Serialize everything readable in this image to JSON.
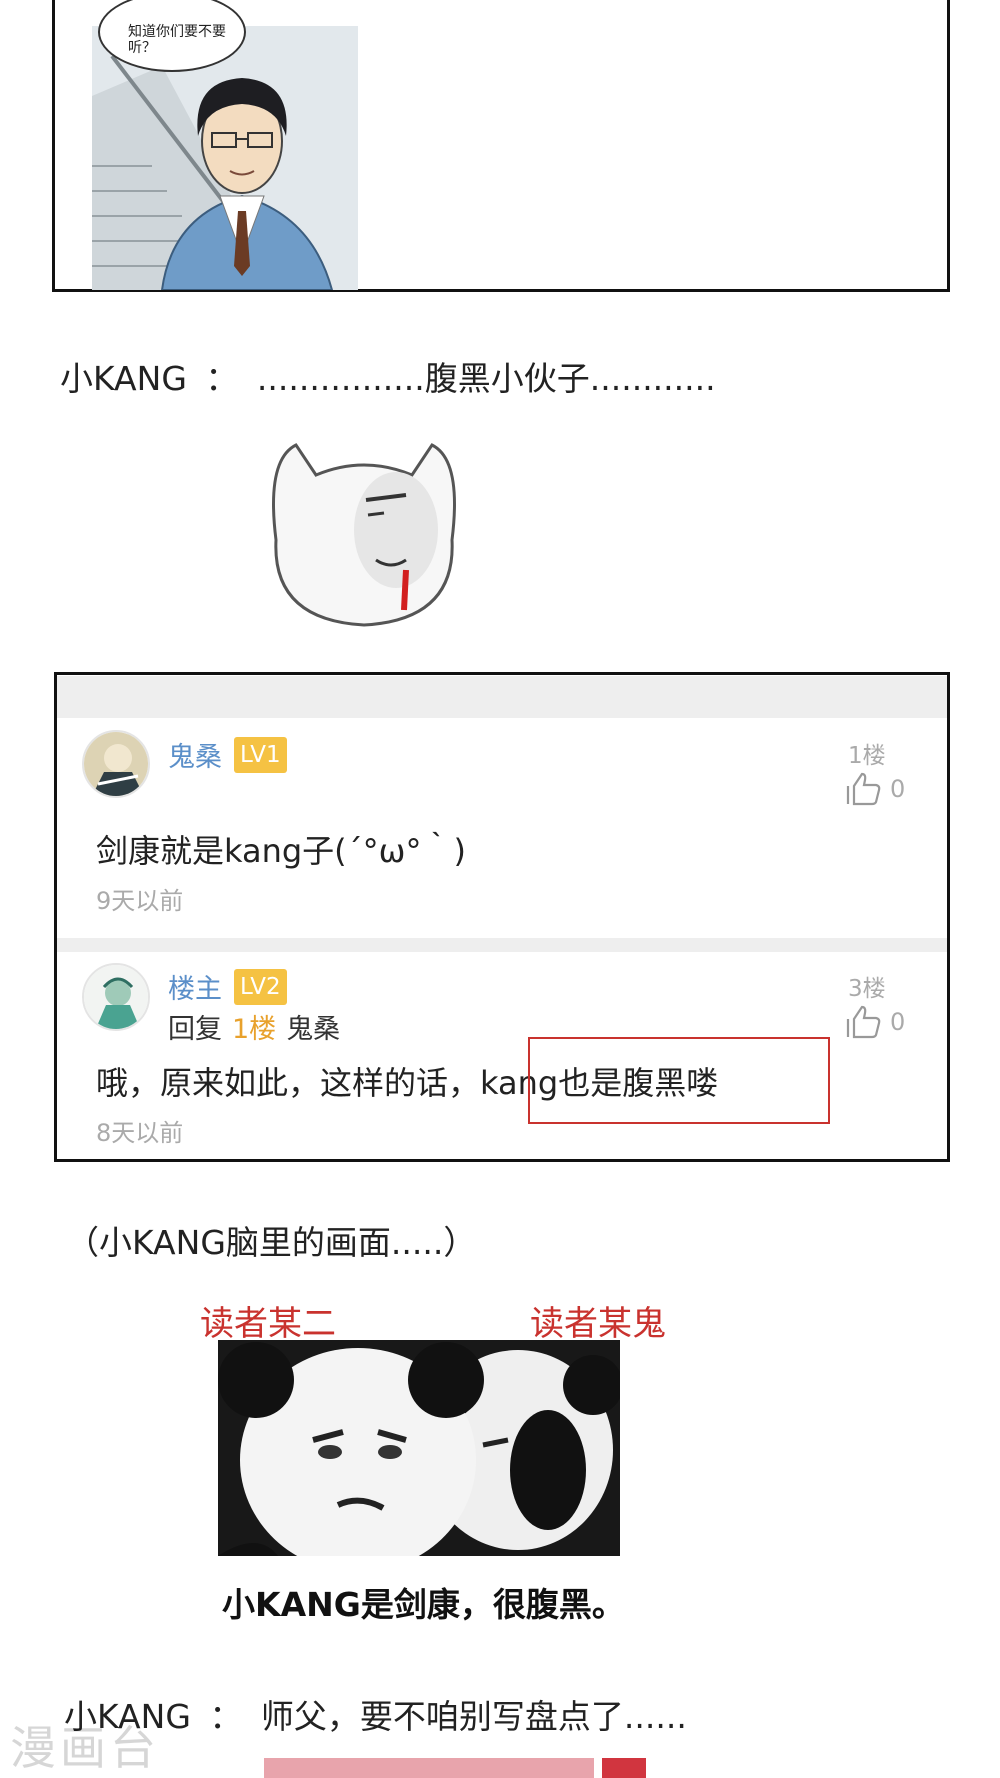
{
  "comic_panel": {
    "speech_bubble": "知道你们要不要听？"
  },
  "line1": {
    "speaker": "小KANG",
    "sep": "：",
    "text": "................腹黑小伙子............"
  },
  "comments": {
    "items": [
      {
        "username": "鬼桑",
        "level": "LV1",
        "floor": "1楼",
        "likes": "0",
        "text": "剑康就是kang子(´°ω°｀)",
        "time": "9天以前"
      },
      {
        "username": "楼主",
        "level": "LV2",
        "floor": "3楼",
        "likes": "0",
        "reply_prefix": "回复",
        "reply_floor": "1楼",
        "reply_user": "鬼桑",
        "text_before": "哦，原来如此，这样的话，",
        "text_highlight": "kang也是腹黑喽",
        "time": "8天以前"
      }
    ]
  },
  "line2": {
    "text": "（小KANG脑里的画面.....）"
  },
  "meme": {
    "label_left": "读者某二",
    "label_right": "读者某鬼",
    "caption": "小KANG是剑康，很腹黑。"
  },
  "line3": {
    "speaker": "小KANG",
    "sep": "：",
    "text": "师父，要不咱别写盘点了......"
  },
  "watermark": "漫画台"
}
